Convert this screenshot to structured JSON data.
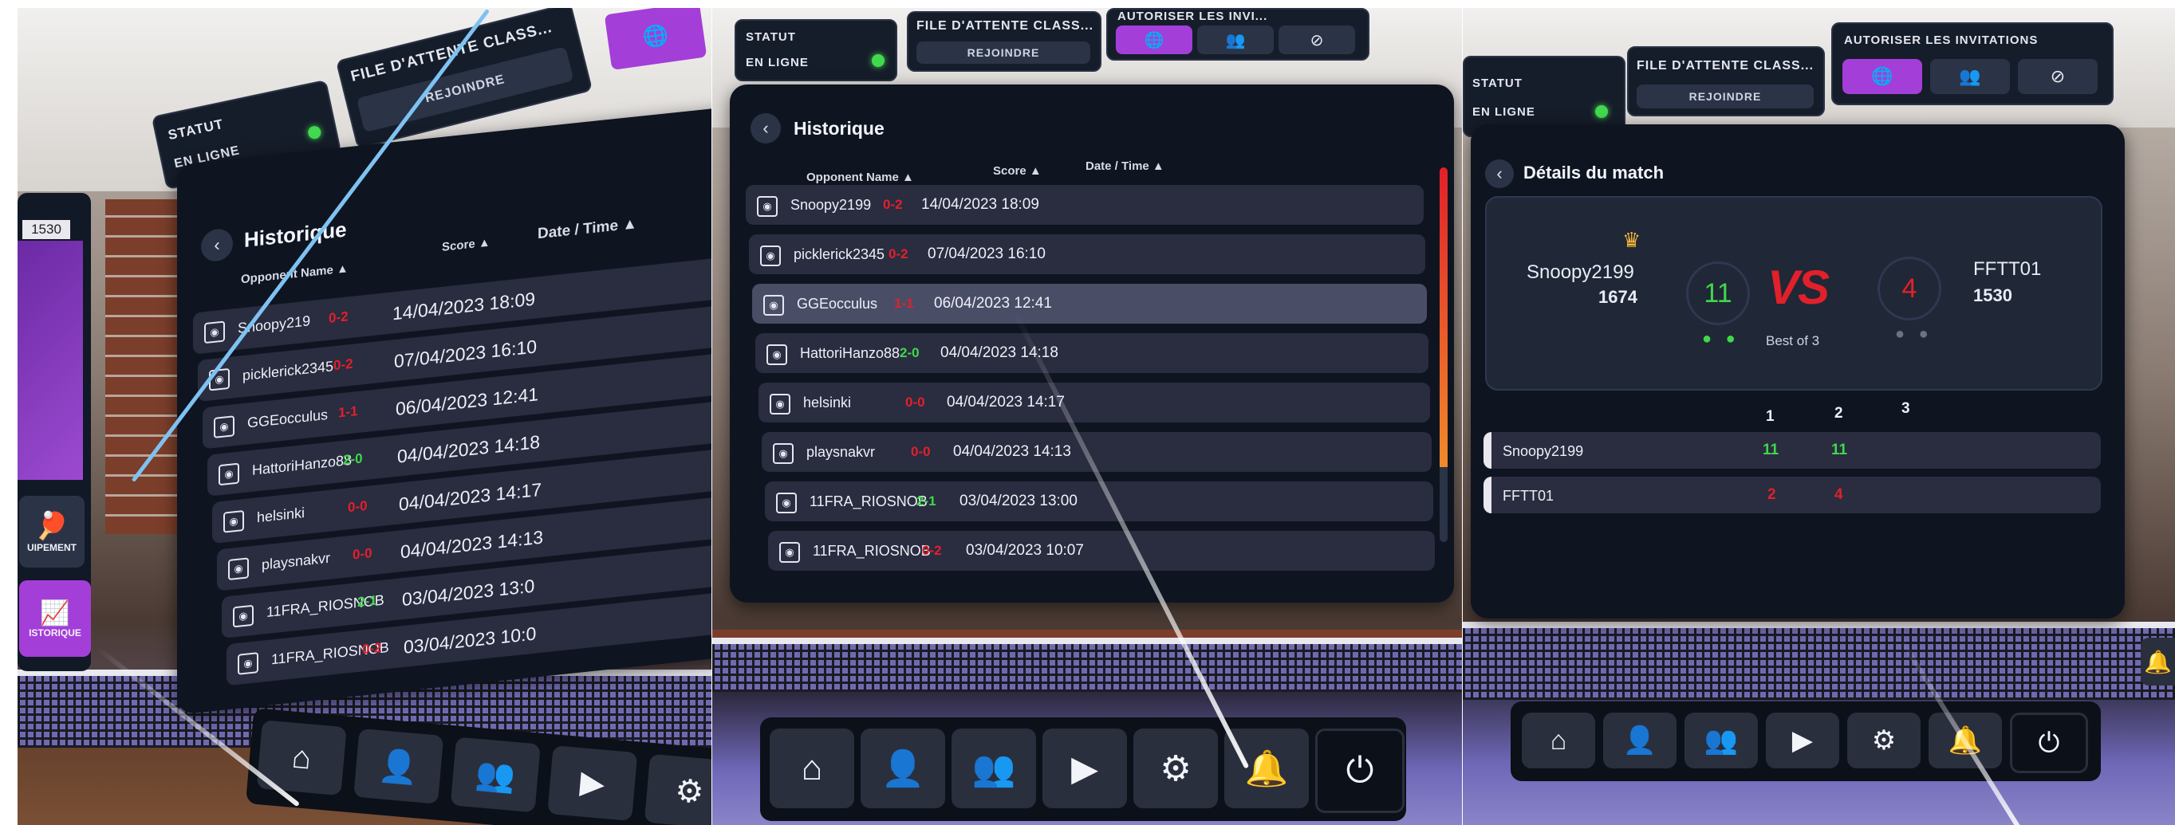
{
  "status": {
    "label": "STATUT",
    "value": "EN LIGNE",
    "color": "#42d94f"
  },
  "queue": {
    "title": "FILE D'ATTENTE CLASS...",
    "title_tilted": "FILE D'ATTENTE CLASS...",
    "join": "REJOINDRE"
  },
  "invitations": {
    "title": "AUTORISER LES INVITATIONS",
    "title_clipped": "AUTORISER LES INVI..."
  },
  "history": {
    "title": "Historique",
    "headers": {
      "opponent": "Opponent Name",
      "score": "Score",
      "date": "Date / Time"
    },
    "rows": [
      {
        "name": "Snoopy2199",
        "score": "0-2",
        "result": "loss",
        "date": "14/04/2023 18:09"
      },
      {
        "name": "picklerick2345",
        "score": "0-2",
        "result": "loss",
        "date": "07/04/2023 16:10"
      },
      {
        "name": "GGEocculus",
        "score": "1-1",
        "result": "loss",
        "date": "06/04/2023 12:41"
      },
      {
        "name": "HattoriHanzo88",
        "score": "2-0",
        "result": "win",
        "date": "04/04/2023 14:18"
      },
      {
        "name": "helsinki",
        "score": "0-0",
        "result": "loss",
        "date": "04/04/2023 14:17"
      },
      {
        "name": "playsnakvr",
        "score": "0-0",
        "result": "loss",
        "date": "04/04/2023 14:13"
      },
      {
        "name": "11FRA_RIOSNOB",
        "score": "2-1",
        "result": "win",
        "date": "03/04/2023 13:00"
      },
      {
        "name": "11FRA_RIOSNOB",
        "score": "0-2",
        "result": "loss",
        "date": "03/04/2023 10:07"
      }
    ]
  },
  "history_left_clipped": {
    "name_0": "Snoopy219",
    "name_1": "picklerick2345",
    "date_6": "03/04/2023 13:0",
    "date_7": "03/04/2023 10:0"
  },
  "side_menu": {
    "rank_value": "1530",
    "equipment": "UIPEMENT",
    "history": "ISTORIQUE"
  },
  "match": {
    "title": "Détails du match",
    "player1": {
      "name": "Snoopy2199",
      "rating": "1674",
      "score": "11"
    },
    "player2": {
      "name": "FFTT01",
      "rating": "1530",
      "score": "4"
    },
    "vs": "VS",
    "best_of": "Best of 3",
    "set_headers": [
      "1",
      "2",
      "3"
    ],
    "sets": [
      {
        "name": "Snoopy2199",
        "values": [
          "11",
          "11"
        ],
        "result": "win"
      },
      {
        "name": "FFTT01",
        "values": [
          "2",
          "4"
        ],
        "result": "loss"
      }
    ]
  },
  "dock": {
    "icons": [
      "home-icon",
      "profile-icon",
      "friends-icon",
      "replay-icon",
      "settings-icon",
      "bell-icon",
      "power-icon"
    ],
    "glyphs": [
      "⌂",
      "👤",
      "👥",
      "▶",
      "⚙",
      "🔔",
      "⏻"
    ]
  },
  "colors": {
    "accent": "#a43ed8",
    "win": "#3fd84a",
    "loss": "#e2202a",
    "panel": "#0e1520",
    "row": "#2a2c40"
  }
}
